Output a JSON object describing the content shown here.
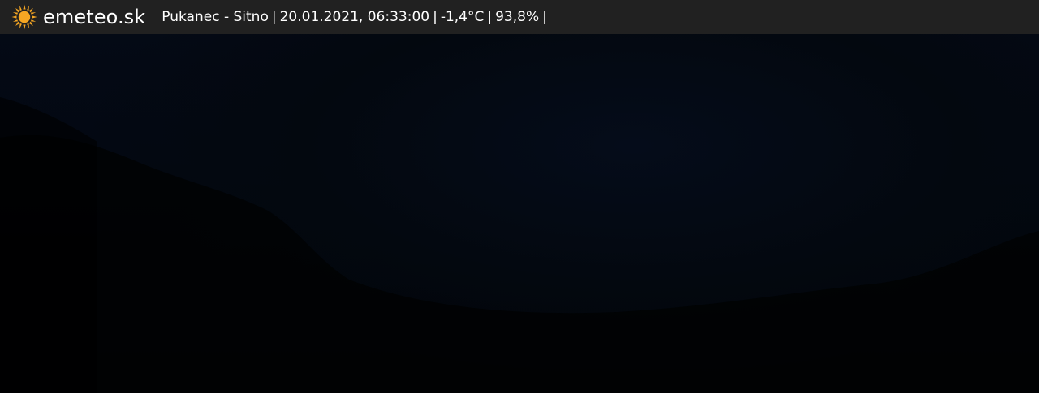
{
  "brand": {
    "name": "emeteo.sk",
    "icon": "sun-icon",
    "icon_color": "#f5a623"
  },
  "station": {
    "location": "Pukanec - Sitno",
    "datetime": "20.01.2021, 06:33:00",
    "temperature": "-1,4°C",
    "humidity": "93,8%",
    "separator": "|"
  },
  "colors": {
    "topbar_bg": "#212121",
    "text": "#ffffff",
    "webcam_bg": "#030812"
  }
}
